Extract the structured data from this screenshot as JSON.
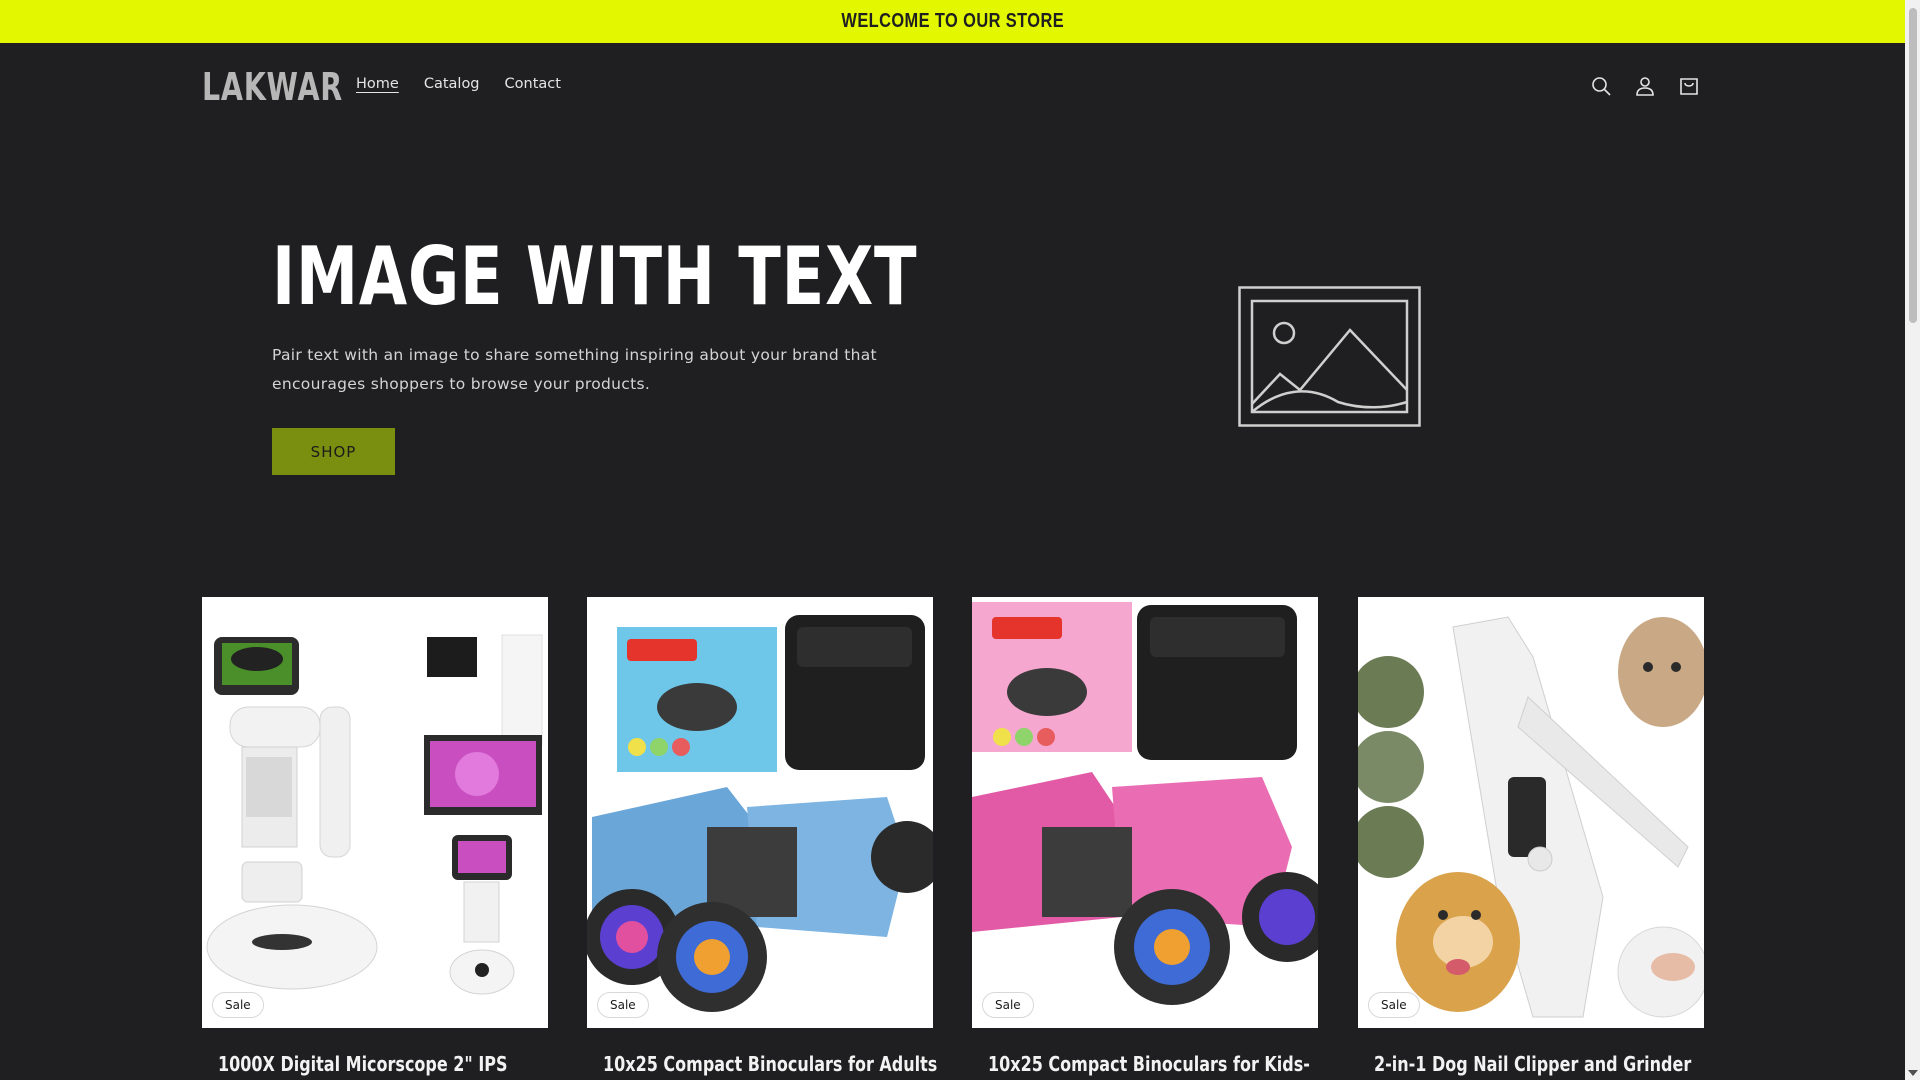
{
  "announcement": {
    "text": "WELCOME TO OUR STORE"
  },
  "header": {
    "logo": "LAKWAR",
    "nav": [
      {
        "label": "Home",
        "active": true
      },
      {
        "label": "Catalog",
        "active": false
      },
      {
        "label": "Contact",
        "active": false
      }
    ],
    "icons": [
      "search-icon",
      "account-icon",
      "cart-icon"
    ]
  },
  "hero": {
    "title": "IMAGE WITH TEXT",
    "text": "Pair text with an image to share something inspiring about your brand that encourages shoppers to browse your products.",
    "button": "SHOP",
    "image_icon": "image-placeholder-icon"
  },
  "products": [
    {
      "title": "1000X Digital Micorscope 2\" IPS",
      "badge": "Sale",
      "image": "digital-microscope"
    },
    {
      "title": "10x25 Compact Binoculars for Adults",
      "badge": "Sale",
      "image": "blue-binoculars"
    },
    {
      "title": "10x25 Compact Binoculars for Kids-",
      "badge": "Sale",
      "image": "pink-binoculars"
    },
    {
      "title": "2-in-1 Dog Nail Clipper and Grinder",
      "badge": "Sale",
      "image": "dog-nail-clipper"
    }
  ],
  "colors": {
    "announcement_bg": "#e3f700",
    "page_bg": "#1f1f21",
    "button_bg": "#7a8f10"
  }
}
